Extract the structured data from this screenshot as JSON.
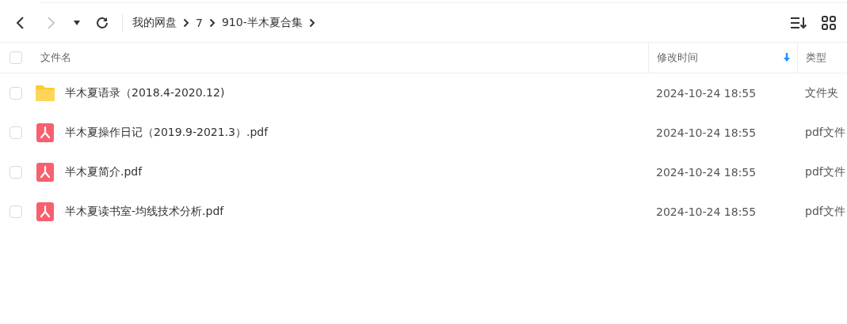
{
  "toolbar": {
    "back_disabled": false,
    "forward_disabled": true,
    "breadcrumb": [
      "我的网盘",
      "7",
      "910-半木夏合集"
    ]
  },
  "table": {
    "columns": [
      {
        "label": "文件名",
        "sorted": false
      },
      {
        "label": "修改时间",
        "sorted": true
      },
      {
        "label": "类型",
        "sorted": false
      }
    ],
    "header_checked": false,
    "rows": [
      {
        "kind": "folder",
        "name": "半木夏语录（2018.4-2020.12)",
        "modified": "2024-10-24 18:55",
        "type": "文件夹",
        "checked": false
      },
      {
        "kind": "pdf",
        "name": "半木夏操作日记（2019.9-2021.3）.pdf",
        "modified": "2024-10-24 18:55",
        "type": "pdf文件",
        "checked": false
      },
      {
        "kind": "pdf",
        "name": "半木夏简介.pdf",
        "modified": "2024-10-24 18:55",
        "type": "pdf文件",
        "checked": false
      },
      {
        "kind": "pdf",
        "name": "半木夏读书室-均线技术分析.pdf",
        "modified": "2024-10-24 18:55",
        "type": "pdf文件",
        "checked": false
      }
    ]
  }
}
